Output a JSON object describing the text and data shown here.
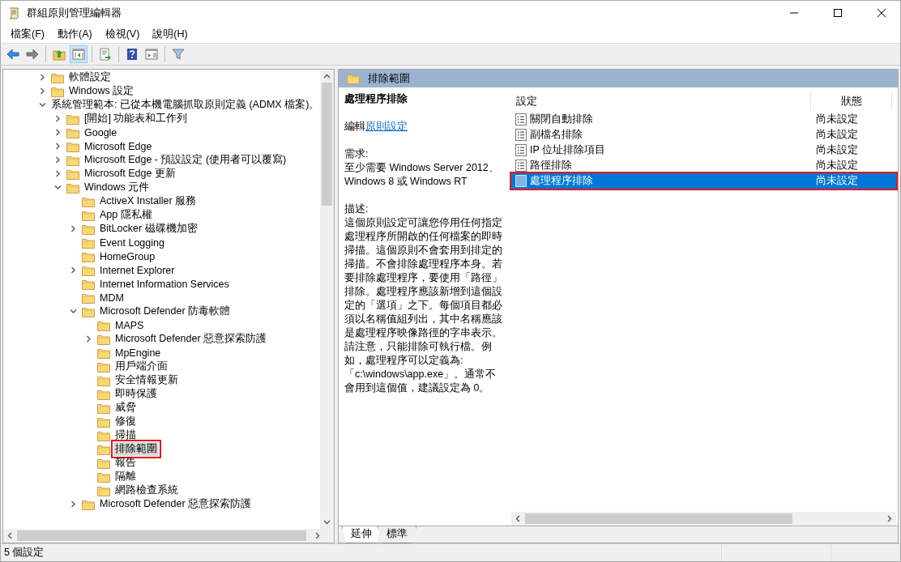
{
  "window": {
    "title": "群組原則管理編輯器"
  },
  "menu": [
    "檔案(F)",
    "動作(A)",
    "檢視(V)",
    "說明(H)"
  ],
  "toolbar": [
    {
      "kind": "back",
      "pressed": false
    },
    {
      "kind": "forward",
      "pressed": false
    },
    {
      "kind": "sep"
    },
    {
      "kind": "up",
      "pressed": false
    },
    {
      "kind": "tree",
      "pressed": true
    },
    {
      "kind": "sep"
    },
    {
      "kind": "export",
      "pressed": false
    },
    {
      "kind": "sep"
    },
    {
      "kind": "help",
      "pressed": false
    },
    {
      "kind": "pane",
      "pressed": false
    },
    {
      "kind": "sep"
    },
    {
      "kind": "filter",
      "pressed": false
    }
  ],
  "tree": [
    {
      "label": "軟體設定",
      "expandable": true,
      "expanded": false,
      "selected": false
    },
    {
      "label": "Windows 設定",
      "expandable": true,
      "expanded": false,
      "selected": false
    },
    {
      "label": "系統管理範本: 已從本機電腦抓取原則定義 (ADMX 檔案)。",
      "expandable": true,
      "expanded": true,
      "selected": false,
      "children": [
        {
          "label": "[開始] 功能表和工作列",
          "expandable": true,
          "expanded": false,
          "selected": false
        },
        {
          "label": "Google",
          "expandable": true,
          "expanded": false,
          "selected": false
        },
        {
          "label": "Microsoft Edge",
          "expandable": true,
          "expanded": false,
          "selected": false
        },
        {
          "label": "Microsoft Edge - 預設設定 (使用者可以覆寫)",
          "expandable": true,
          "expanded": false,
          "selected": false
        },
        {
          "label": "Microsoft Edge 更新",
          "expandable": true,
          "expanded": false,
          "selected": false
        },
        {
          "label": "Windows 元件",
          "expandable": true,
          "expanded": true,
          "selected": false,
          "children": [
            {
              "label": "ActiveX Installer 服務",
              "expandable": false,
              "selected": false
            },
            {
              "label": "App 隱私權",
              "expandable": false,
              "selected": false
            },
            {
              "label": "BitLocker 磁碟機加密",
              "expandable": true,
              "expanded": false,
              "selected": false
            },
            {
              "label": "Event Logging",
              "expandable": false,
              "selected": false
            },
            {
              "label": "HomeGroup",
              "expandable": false,
              "selected": false
            },
            {
              "label": "Internet Explorer",
              "expandable": true,
              "expanded": false,
              "selected": false
            },
            {
              "label": "Internet Information Services",
              "expandable": false,
              "selected": false
            },
            {
              "label": "MDM",
              "expandable": false,
              "selected": false
            },
            {
              "label": "Microsoft Defender 防毒軟體",
              "expandable": true,
              "expanded": true,
              "selected": false,
              "children": [
                {
                  "label": "MAPS",
                  "expandable": false,
                  "selected": false
                },
                {
                  "label": "Microsoft Defender 惡意探索防護",
                  "expandable": true,
                  "expanded": false,
                  "selected": false
                },
                {
                  "label": "MpEngine",
                  "expandable": false,
                  "selected": false
                },
                {
                  "label": "用戶端介面",
                  "expandable": false,
                  "selected": false
                },
                {
                  "label": "安全情報更新",
                  "expandable": false,
                  "selected": false
                },
                {
                  "label": "即時保護",
                  "expandable": false,
                  "selected": false
                },
                {
                  "label": "威脅",
                  "expandable": false,
                  "selected": false
                },
                {
                  "label": "修復",
                  "expandable": false,
                  "selected": false
                },
                {
                  "label": "掃描",
                  "expandable": false,
                  "selected": false
                },
                {
                  "label": "排除範圍",
                  "expandable": false,
                  "selected": true
                },
                {
                  "label": "報告",
                  "expandable": false,
                  "selected": false
                },
                {
                  "label": "隔離",
                  "expandable": false,
                  "selected": false
                },
                {
                  "label": "網路檢查系統",
                  "expandable": false,
                  "selected": false
                }
              ]
            },
            {
              "label": "Microsoft Defender 惡意探索防護",
              "expandable": true,
              "expanded": false,
              "selected": false
            }
          ]
        }
      ]
    }
  ],
  "details": {
    "header": "排除範圍",
    "title": "處理程序排除",
    "edit_prefix": "編輯",
    "edit_link": "原則設定",
    "requirements_label": "需求:",
    "requirements": "至少需要 Windows Server 2012、Windows 8 或 Windows RT",
    "description_label": "描述:",
    "description": "這個原則設定可讓您停用任何指定處理程序所開啟的任何檔案的即時掃描。這個原則不會套用到排定的掃描。不會排除處理程序本身。若要排除處理程序，要使用「路徑」排除。處理程序應該新增到這個設定的「選項」之下。每個項目都必須以名稱值組列出，其中名稱應該是處理程序映像路徑的字串表示。請注意，只能排除可執行檔。例如，處理程序可以定義為:「c:\\windows\\app.exe」。通常不會用到這個值，建議設定為 0。"
  },
  "table": {
    "columns": [
      "設定",
      "狀態"
    ],
    "rows": [
      {
        "name": "關閉自動排除",
        "status": "尚未設定",
        "selected": false
      },
      {
        "name": "副檔名排除",
        "status": "尚未設定",
        "selected": false
      },
      {
        "name": "IP 位址排除項目",
        "status": "尚未設定",
        "selected": false
      },
      {
        "name": "路徑排除",
        "status": "尚未設定",
        "selected": false
      },
      {
        "name": "處理程序排除",
        "status": "尚未設定",
        "selected": true
      }
    ]
  },
  "tabs": [
    {
      "label": "延伸",
      "selected": true
    },
    {
      "label": "標準",
      "selected": false
    }
  ],
  "status_bar": "5 個設定"
}
